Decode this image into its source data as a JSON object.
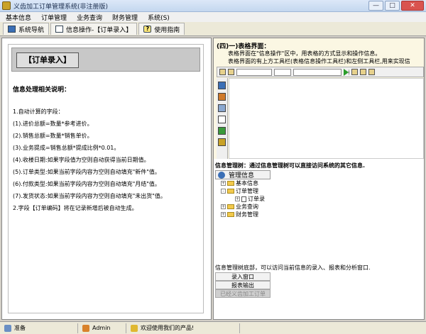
{
  "window": {
    "title": "义齿加工订单管理系统(非注册版)",
    "min": "—",
    "max": "□",
    "close": "✕"
  },
  "menu": [
    "基本信息",
    "订单管理",
    "业务查询",
    "财务管理",
    "系统(S)"
  ],
  "tabs": [
    {
      "label": "系统导航",
      "icon": "nav-icon"
    },
    {
      "label": "信息操作-【订单录入】",
      "icon": "info-icon"
    },
    {
      "label": "使用指南",
      "icon": "help-icon"
    }
  ],
  "left": {
    "header": "【订单录入】",
    "section_title": "信息处理相关说明：",
    "lines": [
      "1.自动计算的字段：",
      "(1).进价总额=数量*参考进价。",
      "(2).销售总额=数量*销售单价。",
      "(3).业务提成=销售总额*提成比例*0.01。",
      "(4).收楼日期:如果字段值为空则自动获得当前日期值。",
      "(5).订单类型:如果当前字段内容为空则自动填充\"新件\"值。",
      "(6).付款类型:如果当前字段内容为空则自动填充\"月结\"值。",
      "(7).发货状态:如果当前字段内容为空则自动填充\"未出货\"值。",
      "2.字段【订单编码】将在记录新增后被自动生成。"
    ]
  },
  "right": {
    "guide_title": "(四)一)表格界面：",
    "guide_line1": "表格界面在\"信息操作\"区中，用表格的方式显示和操作信息。",
    "guide_line2": "表格界面的有上方工具栏(表格信息操作工具栏)和左侧工具栏,用来实现信",
    "tree_title": "信息管理树：通过信息管理树可以直接访问系统的其它信息.",
    "tree_head": "管理信息",
    "tree": [
      {
        "label": "基本信息",
        "level": 1,
        "type": "folder"
      },
      {
        "label": "订单管理",
        "level": 1,
        "type": "folder"
      },
      {
        "label": "订单录",
        "level": 2,
        "type": "doc"
      },
      {
        "label": "业务查询",
        "level": 1,
        "type": "folder"
      },
      {
        "label": "财务管理",
        "level": 1,
        "type": "folder"
      }
    ],
    "bottom_text": "信息管理树底部，可以访问当前信息的录入、报表和分析窗口.",
    "windows": [
      "录入窗口",
      "报表输出",
      "已经义齿加工订单"
    ]
  },
  "status": {
    "ready": "准备",
    "user": "Admin",
    "welcome": "欢迎使用我们的产品!"
  },
  "colors": {
    "guide_bg": "#fbf7e3",
    "accent": "#3b6fb6"
  }
}
